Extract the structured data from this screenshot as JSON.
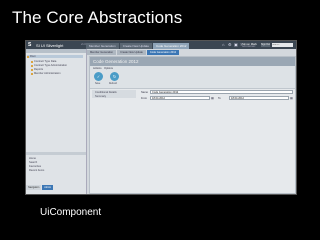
{
  "slide": {
    "title": "The Core Abstractions",
    "caption": "UiComponent"
  },
  "app": {
    "logo": "S",
    "name": "SI UI Silverlight",
    "version": "v1.0",
    "top_tabs": [
      "Member Generation",
      "Create New Update",
      "Code Generation 2012"
    ],
    "active_top_tab": 2,
    "user": {
      "name": "Simon Mark",
      "role": "Administrator"
    },
    "signout_label": "Sign Out",
    "search_placeholder": "Search"
  },
  "sidebar": {
    "header": "",
    "tree": [
      {
        "label": "Root",
        "selected": true
      },
      {
        "label": "Contract Type Data",
        "selected": false
      },
      {
        "label": "Contract Type Administration",
        "selected": false
      },
      {
        "label": "Reports",
        "selected": false
      },
      {
        "label": "Member Administration",
        "selected": false
      }
    ],
    "links": [
      "Home",
      "Search",
      "Favourites",
      "Recent Items"
    ],
    "tabs": [
      "Navigation",
      "Admin"
    ],
    "active_tab": 1
  },
  "main": {
    "doc_tabs": [
      "Member Generation",
      "Create New Update",
      "Code Generation 2012"
    ],
    "active_doc_tab": 2,
    "panel_title": "Code Generation 2012",
    "ribbon": {
      "tabs": [
        "Actions",
        "Options"
      ],
      "buttons": [
        {
          "icon": "save-icon",
          "label": "Save"
        },
        {
          "icon": "refresh-icon",
          "label": "Refresh"
        }
      ]
    },
    "sections": [
      "Conditional Details",
      "Summary"
    ],
    "form": {
      "name_label": "Name",
      "name_value": "Code Generation 2012",
      "from_label": "From",
      "from_value": "18.04.2012",
      "to_label": "To",
      "to_value": "18.04.2012"
    }
  }
}
